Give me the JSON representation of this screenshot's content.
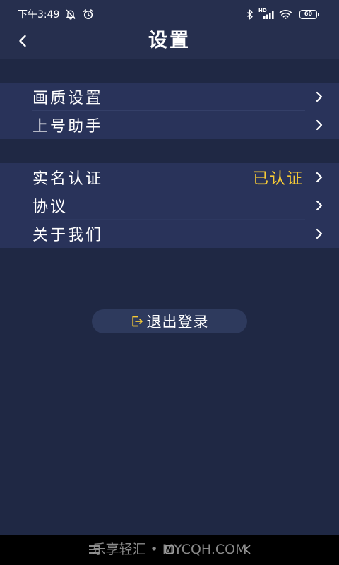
{
  "status_bar": {
    "time": "下午3:49",
    "left_icons": [
      "mute-notification-icon",
      "alarm-icon"
    ],
    "right_icons": [
      "bluetooth-icon",
      "signal-icon",
      "wifi-icon",
      "battery-icon"
    ],
    "network_label": "HD",
    "battery_level": "60"
  },
  "header": {
    "back_icon": "chevron-left-icon",
    "title": "设置"
  },
  "groups": [
    {
      "items": [
        {
          "label": "画质设置",
          "icon": "chevron-right-icon"
        },
        {
          "label": "上号助手",
          "icon": "chevron-right-icon"
        }
      ]
    },
    {
      "items": [
        {
          "label": "实名认证",
          "value": "已认证",
          "icon": "chevron-right-icon"
        },
        {
          "label": "协议",
          "icon": "chevron-right-icon"
        },
        {
          "label": "关于我们",
          "icon": "chevron-right-icon"
        }
      ]
    }
  ],
  "logout": {
    "icon": "logout-icon",
    "label": "退出登录"
  },
  "nav_bar": {
    "icons": [
      "menu-icon",
      "home-icon",
      "system-back-icon"
    ],
    "watermark": "乐享轻汇 • MYCQH.COM"
  },
  "theme": {
    "background": "#1f2844",
    "header": "#262f4e",
    "row": "#29335a",
    "divider": "#343f68",
    "button": "#2e3a5d",
    "accent": "#f7cb35",
    "text": "#ffffff",
    "nav_bar": "#000000"
  }
}
